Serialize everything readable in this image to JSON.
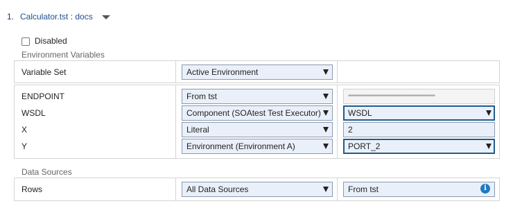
{
  "header": {
    "number": "1.",
    "title": "Calculator.tst : docs",
    "collapse_icon": "triangle-down-icon"
  },
  "disabled_checkbox": {
    "label": "Disabled",
    "checked": false
  },
  "env_section": {
    "label": "Environment Variables"
  },
  "variable_set": {
    "label": "Variable Set",
    "value": "Active Environment"
  },
  "variables": [
    {
      "name": "ENDPOINT",
      "type": "From tst",
      "value": "••••••••••••••••••••••••••••••••••••••••••••••••••"
    },
    {
      "name": "WSDL",
      "type": "Component (SOAtest Test Executor)",
      "value": "WSDL"
    },
    {
      "name": "X",
      "type": "Literal",
      "value": "2"
    },
    {
      "name": "Y",
      "type": "Environment (Environment A)",
      "value": "PORT_2"
    }
  ],
  "data_section": {
    "label": "Data Sources"
  },
  "rows": {
    "label": "Rows",
    "type": "All Data Sources",
    "value": "From tst",
    "info_icon": "info-icon"
  },
  "colors": {
    "link": "#1f4e8c",
    "select_bg": "#eaf0f9",
    "focus_border": "#1f5c8c",
    "info": "#1f7ac2"
  }
}
